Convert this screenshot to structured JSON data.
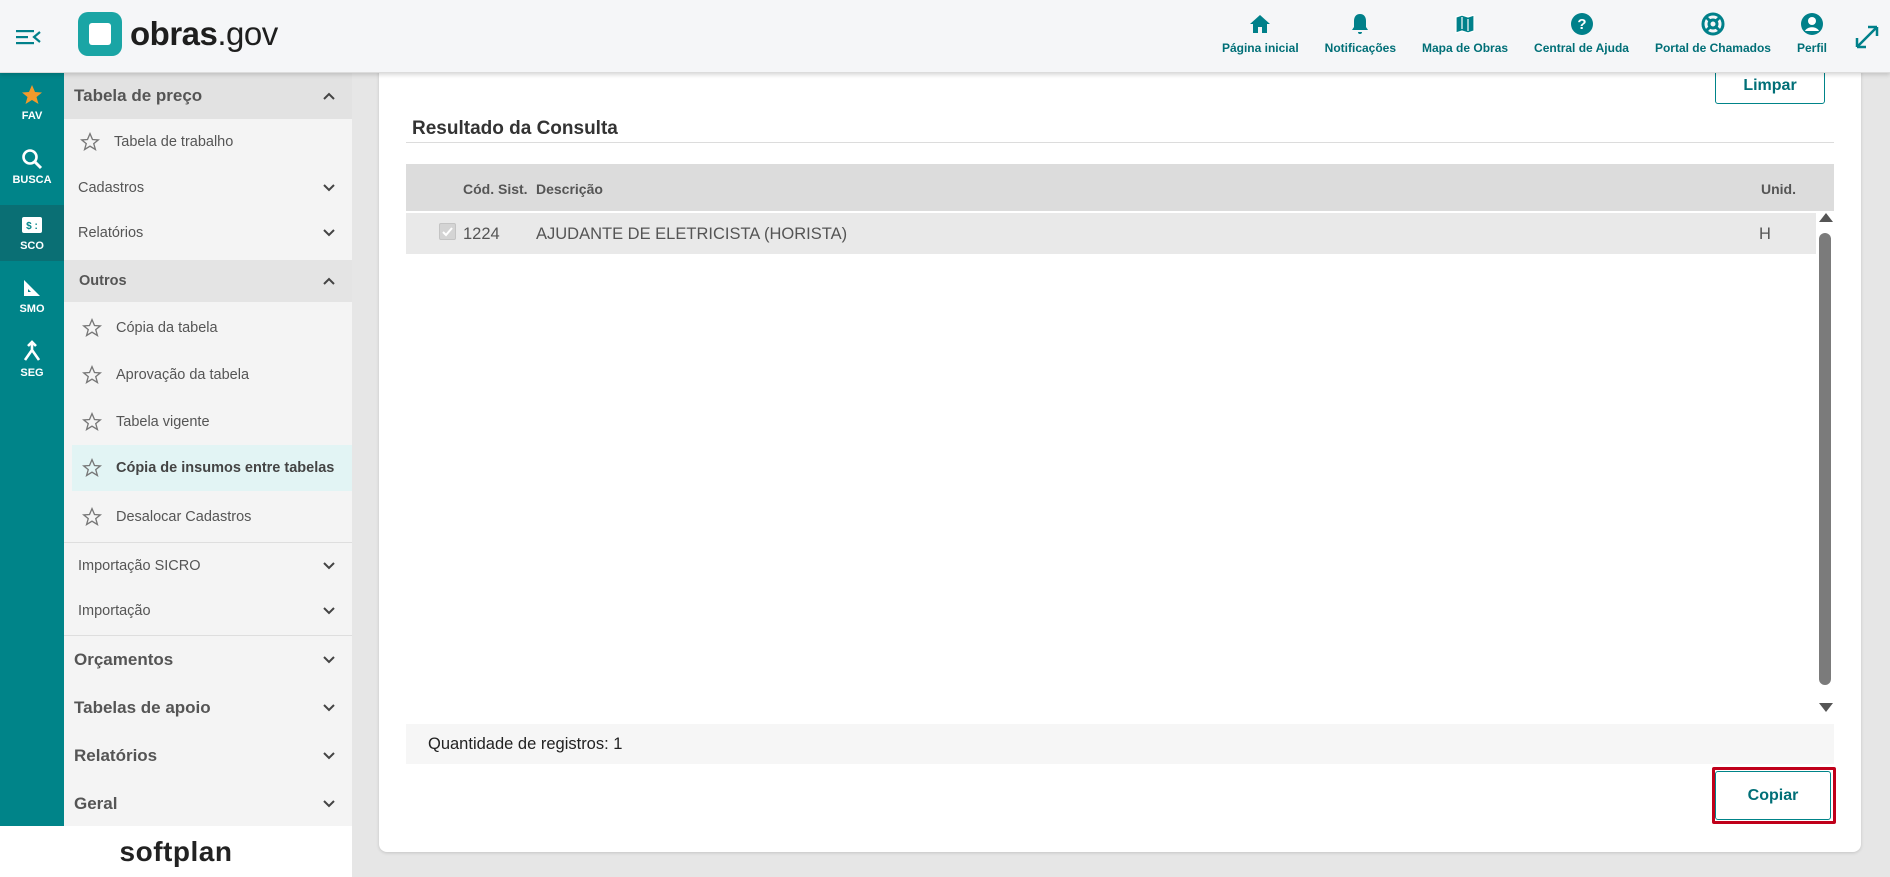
{
  "header": {
    "logo_bold": "obras",
    "logo_light": ".gov",
    "nav": [
      {
        "label": "Página inicial",
        "icon": "home-icon"
      },
      {
        "label": "Notificações",
        "icon": "bell-icon"
      },
      {
        "label": "Mapa de Obras",
        "icon": "map-icon"
      },
      {
        "label": "Central de Ajuda",
        "icon": "help-icon"
      },
      {
        "label": "Portal de Chamados",
        "icon": "lifebuoy-icon"
      },
      {
        "label": "Perfil",
        "icon": "user-icon"
      }
    ]
  },
  "rail": [
    {
      "label": "FAV",
      "icon": "star-icon"
    },
    {
      "label": "BUSCA",
      "icon": "search-icon"
    },
    {
      "label": "SCO",
      "icon": "sco-icon"
    },
    {
      "label": "SMO",
      "icon": "ruler-icon"
    },
    {
      "label": "SEG",
      "icon": "merge-icon"
    }
  ],
  "sidebar": {
    "tabela_preco": "Tabela de preço",
    "tabela_trabalho": "Tabela de trabalho",
    "cadastros": "Cadastros",
    "relatorios_sub": "Relatórios",
    "outros": "Outros",
    "outros_items": [
      "Cópia da tabela",
      "Aprovação da tabela",
      "Tabela vigente",
      "Cópia de insumos entre tabelas",
      "Desalocar Cadastros"
    ],
    "importacao_sicro": "Importação SICRO",
    "importacao": "Importação",
    "orcamentos": "Orçamentos",
    "tabelas_apoio": "Tabelas de apoio",
    "relatorios": "Relatórios",
    "geral": "Geral"
  },
  "footer": {
    "brand": "softplan"
  },
  "main": {
    "limpar_label": "Limpar",
    "section_title": "Resultado da Consulta",
    "columns": {
      "cod": "Cód. Sist.",
      "desc": "Descrição",
      "unid": "Unid."
    },
    "rows": [
      {
        "cod": "1224",
        "desc": "AJUDANTE DE ELETRICISTA (HORISTA)",
        "unid": "H",
        "checked": true
      }
    ],
    "count_text": "Quantidade de registros: 1",
    "copiar_label": "Copiar"
  },
  "colors": {
    "primary": "#008489",
    "highlight": "#c0001a",
    "logo": "#1aa5a5"
  }
}
